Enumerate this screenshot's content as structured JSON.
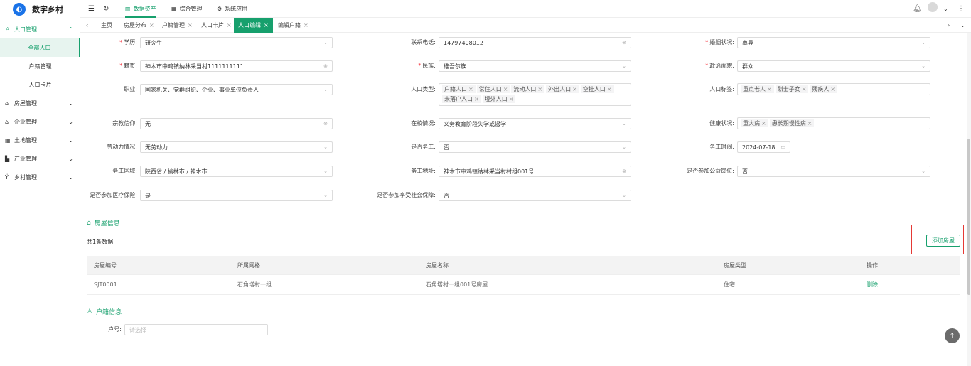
{
  "brand": {
    "logo_text": "数字乡村",
    "accent": "#17a06d"
  },
  "topbar": {
    "icons": [
      "menu-fold-icon",
      "refresh-icon"
    ],
    "items": [
      "数据资产",
      "综合管理",
      "系统应用"
    ],
    "active": 0
  },
  "tabs": {
    "items": [
      {
        "label": "主页",
        "closable": false
      },
      {
        "label": "房屋分布",
        "closable": true
      },
      {
        "label": "户籍管理",
        "closable": true
      },
      {
        "label": "人口卡片",
        "closable": true
      },
      {
        "label": "人口编辑",
        "closable": true
      },
      {
        "label": "编辑户籍",
        "closable": true
      }
    ],
    "active": 4
  },
  "sidebar": {
    "groups": [
      {
        "label": "人口管理",
        "icon": "user-icon",
        "expanded": true,
        "children": [
          "全部人口",
          "户籍管理",
          "人口卡片"
        ],
        "active_child": 0
      },
      {
        "label": "房屋管理",
        "icon": "home-icon"
      },
      {
        "label": "企业管理",
        "icon": "bank-icon"
      },
      {
        "label": "土地管理",
        "icon": "grid-icon"
      },
      {
        "label": "产业管理",
        "icon": "chart-icon"
      },
      {
        "label": "乡村管理",
        "icon": "village-icon"
      }
    ]
  },
  "form": {
    "education": {
      "label": "学历:",
      "value": "研究生",
      "required": true
    },
    "phone": {
      "label": "联系电话:",
      "value": "14797408012"
    },
    "marital": {
      "label": "婚姻状况:",
      "value": "离异",
      "required": true
    },
    "native": {
      "label": "籍贯:",
      "value": "神木市中鸡镇纳林采当村1111111111",
      "required": true
    },
    "ethnicity": {
      "label": "民族:",
      "value": "维吾尔族",
      "required": true
    },
    "political": {
      "label": "政治面貌:",
      "value": "群众",
      "required": true
    },
    "occupation": {
      "label": "职业:",
      "value": "国家机关、党群组织、企业、事业单位负责人"
    },
    "pop_type": {
      "label": "人口类型:",
      "tags": [
        "户籍人口",
        "常住人口",
        "流动人口",
        "外出人口",
        "空挂人口",
        "未落户人口",
        "境外人口"
      ]
    },
    "pop_tags": {
      "label": "人口标签:",
      "tags": [
        "重点老人",
        "烈士子女",
        "残疾人"
      ]
    },
    "religion": {
      "label": "宗教信仰:",
      "value": "无"
    },
    "school": {
      "label": "在校情况:",
      "value": "义务教育阶段失学或辍学"
    },
    "health": {
      "label": "健康状况:",
      "tags": [
        "重大病",
        "患长期慢性病"
      ]
    },
    "labor": {
      "label": "劳动力情况:",
      "value": "无劳动力"
    },
    "is_worker": {
      "label": "是否务工:",
      "value": "否"
    },
    "work_time": {
      "label": "务工时间:",
      "value": "2024-07-18"
    },
    "work_area": {
      "label": "务工区域:",
      "value": "陕西省 / 榆林市 / 神木市"
    },
    "work_addr": {
      "label": "务工地址:",
      "value": "神木市中鸡镇纳林采当村村组001号"
    },
    "public_post": {
      "label": "是否参加公益岗位:",
      "value": "否"
    },
    "medical": {
      "label": "是否参加医疗保险:",
      "value": "是"
    },
    "social": {
      "label": "是否参加享受社会保障:",
      "value": "否"
    }
  },
  "house": {
    "section_title": "房屋信息",
    "count_text": "共1条数据",
    "add_button": "添加房屋",
    "columns": [
      "房屋编号",
      "所属网格",
      "房屋名称",
      "房屋类型",
      "操作"
    ],
    "rows": [
      {
        "id": "SJT0001",
        "grid": "石角塔村一组",
        "name": "石角塔村一组001号房屋",
        "type": "住宅",
        "action": "删除"
      }
    ]
  },
  "household": {
    "section_title": "户籍信息",
    "label": "户号:",
    "placeholder": "请选择"
  }
}
